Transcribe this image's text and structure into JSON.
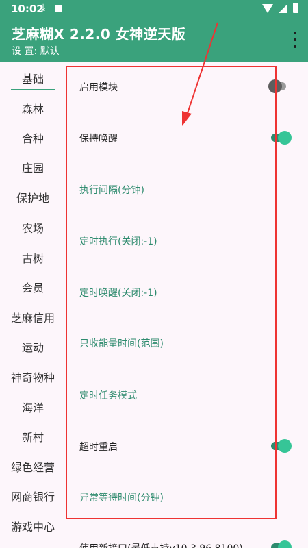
{
  "status": {
    "time": "10:02"
  },
  "appbar": {
    "title": "芝麻糊X 2.2.0 女神逆天版",
    "subtitle": "设 置: 默认"
  },
  "sidebar": {
    "items": [
      {
        "label": "基础"
      },
      {
        "label": "森林"
      },
      {
        "label": "合种"
      },
      {
        "label": "庄园"
      },
      {
        "label": "保护地"
      },
      {
        "label": "农场"
      },
      {
        "label": "古树"
      },
      {
        "label": "会员"
      },
      {
        "label": "芝麻信用"
      },
      {
        "label": "运动"
      },
      {
        "label": "神奇物种"
      },
      {
        "label": "海洋"
      },
      {
        "label": "新村"
      },
      {
        "label": "绿色经营"
      },
      {
        "label": "网商银行"
      },
      {
        "label": "游戏中心"
      }
    ],
    "active_index": 0
  },
  "settings": {
    "rows": [
      {
        "label": "启用模块",
        "style": "black",
        "toggle": "off"
      },
      {
        "label": "保持唤醒",
        "style": "black",
        "toggle": "on"
      },
      {
        "label": "执行间隔(分钟)",
        "style": "green"
      },
      {
        "label": "定时执行(关闭:-1)",
        "style": "green"
      },
      {
        "label": "定时唤醒(关闭:-1)",
        "style": "green"
      },
      {
        "label": "只收能量时间(范围)",
        "style": "green"
      },
      {
        "label": "定时任务模式",
        "style": "green"
      },
      {
        "label": "超时重启",
        "style": "black",
        "toggle": "on"
      },
      {
        "label": "异常等待时间(分钟)",
        "style": "green"
      },
      {
        "label": "使用新接口(最低支持v10.3.96.8100)",
        "style": "black",
        "toggle": "on"
      }
    ]
  },
  "colors": {
    "accent": "#3aa27c",
    "annotation": "#ee3333",
    "link": "#2e8b6e"
  }
}
